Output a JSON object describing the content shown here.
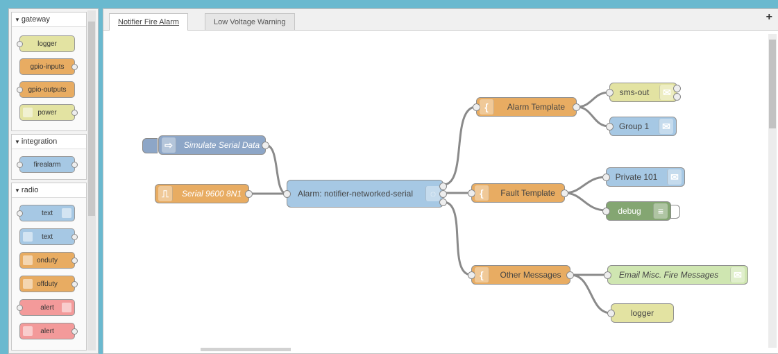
{
  "palette": {
    "categories": [
      {
        "name": "gateway",
        "nodes": [
          "logger",
          "gpio-inputs",
          "gpio-outputs",
          "power"
        ]
      },
      {
        "name": "integration",
        "nodes": [
          "firealarm"
        ]
      },
      {
        "name": "radio",
        "nodes": [
          "text",
          "text",
          "onduty",
          "offduty",
          "alert",
          "alert"
        ]
      }
    ]
  },
  "tabs": [
    "Notifier Fire Alarm",
    "Low Voltage Warning"
  ],
  "add_tab_label": "+",
  "flow": {
    "simulate": "Simulate Serial Data",
    "serial": "Serial 9600 8N1",
    "alarm": "Alarm: notifier-networked-serial",
    "alarm_template": "Alarm Template",
    "fault_template": "Fault Template",
    "other_messages": "Other Messages",
    "sms_out": "sms-out",
    "group1": "Group 1",
    "private101": "Private 101",
    "debug": "debug",
    "email": "Email Misc. Fire Messages",
    "logger": "logger"
  },
  "colors": {
    "background": "#6ab9cf",
    "function_node": "#e8ac62",
    "radio_node": "#a6c8e4",
    "gateway_node": "#e3e3a2",
    "debug_node": "#84a672",
    "alert_node": "#f39a9a"
  }
}
